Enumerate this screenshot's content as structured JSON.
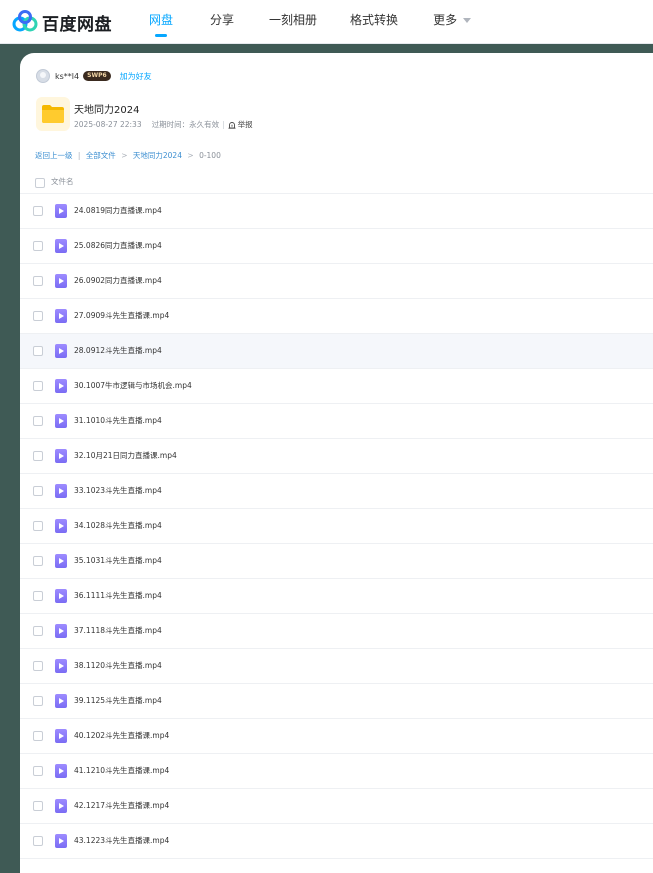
{
  "header": {
    "logo_text": "百度网盘",
    "nav": [
      {
        "label": "网盘",
        "active": true
      },
      {
        "label": "分享",
        "active": false
      },
      {
        "label": "一刻相册",
        "active": false
      },
      {
        "label": "格式转换",
        "active": false
      },
      {
        "label": "更多",
        "active": false,
        "has_dropdown": true
      }
    ]
  },
  "share": {
    "user_name": "ks**l4",
    "badge": "SWP6",
    "add_friend": "加为好友",
    "folder_icon": "folder-icon",
    "title": "天地同力2024",
    "date": "2025-08-27 22:33",
    "expire_label": "过期时间：永久有效",
    "report_label": "举报"
  },
  "breadcrumb": {
    "back": "返回上一级",
    "sep_bar": "|",
    "all_files": "全部文件",
    "arrow": ">",
    "folder": "天地同力2024",
    "current": "0-100"
  },
  "list": {
    "header_label": "文件名",
    "file_icon": "video-file-icon",
    "files": [
      "24.0819同力直播课.mp4",
      "25.0826同力直播课.mp4",
      "26.0902同力直播课.mp4",
      "27.0909斗先生直播课.mp4",
      "28.0912斗先生直播.mp4",
      "30.1007牛市逻辑与市场机会.mp4",
      "31.1010斗先生直播.mp4",
      "32.10月21日同力直播课.mp4",
      "33.1023斗先生直播.mp4",
      "34.1028斗先生直播.mp4",
      "35.1031斗先生直播.mp4",
      "36.1111斗先生直播.mp4",
      "37.1118斗先生直播.mp4",
      "38.1120斗先生直播.mp4",
      "39.1125斗先生直播.mp4",
      "40.1202斗先生直播课.mp4",
      "41.1210斗先生直播课.mp4",
      "42.1217斗先生直播课.mp4",
      "43.1223斗先生直播课.mp4"
    ]
  },
  "colors": {
    "accent": "#06a7ff",
    "background": "#3f5a55",
    "video_icon": "#8b7cf8"
  }
}
